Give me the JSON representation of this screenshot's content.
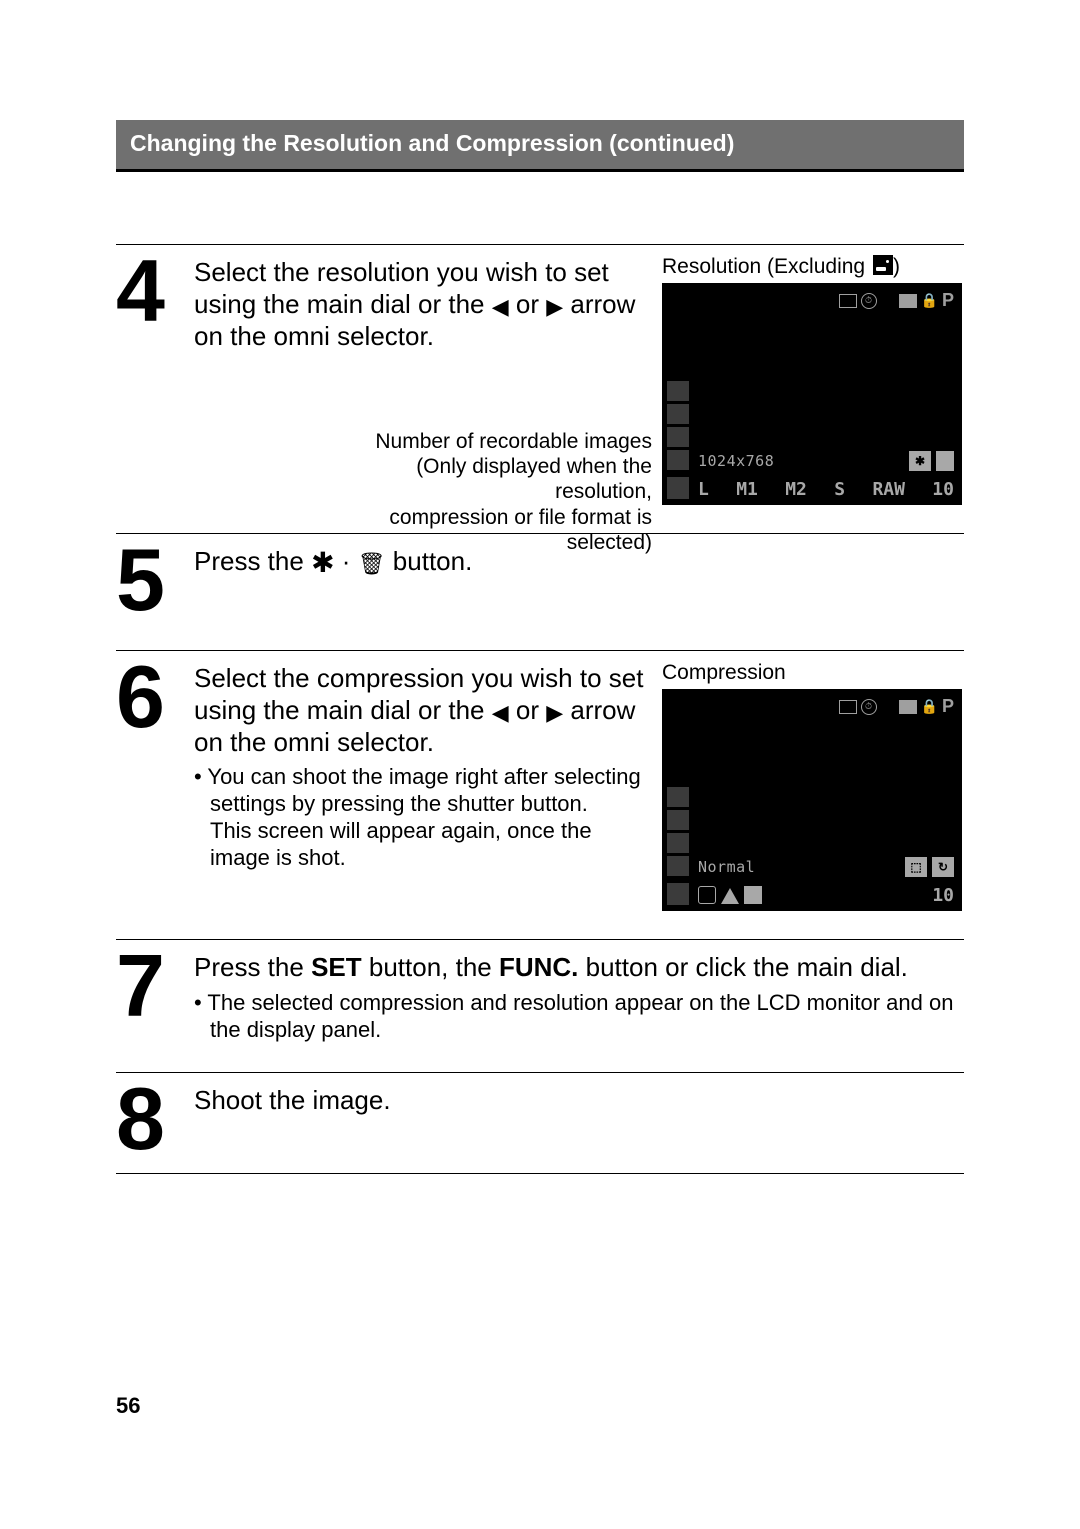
{
  "header": {
    "title": "Changing the Resolution and Compression (continued)"
  },
  "step4": {
    "num": "4",
    "instr_part1": "Select the resolution you wish to set using the main dial or the ",
    "arrow_left": "◀",
    "instr_or": " or ",
    "arrow_right": "▶",
    "instr_part2": " arrow on the omni selector.",
    "fig_label_prefix": "Resolution (Excluding ",
    "fig_label_suffix": ")",
    "callout_l1": "Number of recordable images",
    "callout_l2": "(Only displayed when the resolution,",
    "callout_l3": "compression or file format is selected)",
    "lcd": {
      "info_text": "1024x768",
      "bottom": {
        "L": "L",
        "M1": "M1",
        "M2": "M2",
        "S": "S",
        "RAW": "RAW",
        "count": "10"
      },
      "mode_p": "P"
    }
  },
  "step5": {
    "num": "5",
    "instr_pre": "Press the ",
    "asterisk": "✱",
    "dot": " · ",
    "instr_post": " button."
  },
  "step6": {
    "num": "6",
    "instr_part1": "Select the compression you wish to set using the main dial or the ",
    "arrow_left": "◀",
    "instr_or": " or ",
    "arrow_right": "▶",
    "instr_part2": " arrow on the omni selector.",
    "sub1": "You can shoot the image right after selecting settings by pressing the shutter button.",
    "sub2": "This screen will appear again, once the image is shot.",
    "fig_label": "Compression",
    "lcd": {
      "info_text": "Normal",
      "bottom_count": "10",
      "mode_p": "P"
    }
  },
  "step7": {
    "num": "7",
    "instr_pre": "Press the ",
    "set": "SET",
    "instr_mid": " button, the ",
    "func": "FUNC.",
    "instr_post": " button or click the main dial.",
    "sub": "The selected compression and resolution appear on the LCD monitor and on the display panel."
  },
  "step8": {
    "num": "8",
    "instr": "Shoot the image."
  },
  "page_number": "56"
}
